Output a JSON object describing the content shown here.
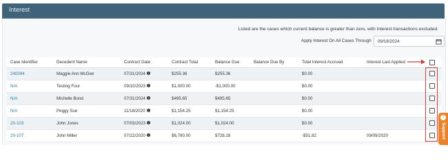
{
  "panel": {
    "title": "Interest"
  },
  "info_text": "Listed are the cases which current balance is greater than zero, with Interest transactions excluded.",
  "apply_interest": {
    "label": "Apply Interest On All Cases Through",
    "date_value": "09/18/2024"
  },
  "table": {
    "headers": [
      "Case Identifier",
      "Decedent Name",
      "Contract Date",
      "Contract Total",
      "Balance Due",
      "Balance Due By",
      "Total Interest Accrued",
      "Interest Last Applied"
    ],
    "rows": [
      {
        "case_id": "240094",
        "decedent": "Maggie Ann McGee",
        "contract_date": "07/31/2024",
        "contract_total": "$255.36",
        "balance_due": "$255.36",
        "balance_due_by": "",
        "total_interest": "$0.00",
        "last_applied": ""
      },
      {
        "case_id": "N/A",
        "decedent": "Testing Four",
        "contract_date": "09/10/2023",
        "contract_total": "$1,000.00",
        "balance_due": "-$1,000.00",
        "balance_due_by": "",
        "total_interest": "$0.00",
        "last_applied": ""
      },
      {
        "case_id": "N/A",
        "decedent": "Michelle Bond",
        "contract_date": "07/31/2024",
        "contract_total": "$495.65",
        "balance_due": "$495.65",
        "balance_due_by": "",
        "total_interest": "$0.00",
        "last_applied": ""
      },
      {
        "case_id": "N/A",
        "decedent": "Peggy Sue",
        "contract_date": "11/18/2020",
        "contract_total": "$1,154.25",
        "balance_due": "$1,154.25",
        "balance_due_by": "",
        "total_interest": "$0.00",
        "last_applied": ""
      },
      {
        "case_id": "20-103",
        "decedent": "John Jones",
        "contract_date": "07/03/2023",
        "contract_total": "$1,024.00",
        "balance_due": "$1,024.00",
        "balance_due_by": "",
        "total_interest": "$0.00",
        "last_applied": ""
      },
      {
        "case_id": "20-107",
        "decedent": "John Miller",
        "contract_date": "07/22/2020",
        "contract_total": "$6,780.00",
        "balance_due": "$728.18",
        "balance_due_by": "",
        "total_interest": "-$51.82",
        "last_applied": "09/09/2020"
      }
    ]
  },
  "support": {
    "label": "Support"
  },
  "colors": {
    "header_bg": "#3f6378",
    "link": "#2d78a8",
    "highlight": "#d23a3a",
    "support": "#e9832b"
  },
  "icons": {
    "calendar": "calendar-icon",
    "info": "info-icon",
    "arrow": "red-arrow-annotation"
  }
}
